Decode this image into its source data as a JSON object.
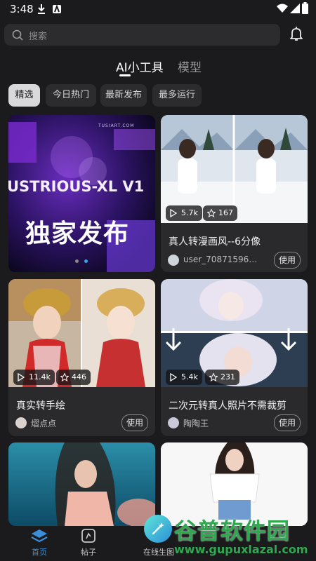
{
  "status": {
    "time": "3:48"
  },
  "search": {
    "placeholder": "搜索"
  },
  "tabs": [
    {
      "label": "AI小工具"
    },
    {
      "label": "模型"
    }
  ],
  "chips": [
    {
      "label": "精选"
    },
    {
      "label": "今日热门"
    },
    {
      "label": "最新发布"
    },
    {
      "label": "最多运行"
    }
  ],
  "banner": {
    "brand": "TUSIART.COM",
    "headline": "USTRIOUS-XL V1",
    "subtitle": "独家发布"
  },
  "cards": [
    {
      "title": "真人转漫画风--6分像",
      "user": "user_7087159680...",
      "runs": "5.7k",
      "stars": "167",
      "button": "使用"
    },
    {
      "title": "真实转手绘",
      "user": "熠点点",
      "runs": "11.4k",
      "stars": "446",
      "button": "使用"
    },
    {
      "title": "二次元转真人照片不需裁剪",
      "user": "陶陶王",
      "runs": "5.4k",
      "stars": "231",
      "button": "使用"
    }
  ],
  "bottom_nav": [
    {
      "label": "首页"
    },
    {
      "label": "帖子"
    },
    {
      "label": "在线生图"
    }
  ],
  "watermark": {
    "text_main": "谷普软件园",
    "text_url": "www.gupuxlazal.com"
  },
  "colors": {
    "accent": "#3b8fd8",
    "background": "#1b1b1d",
    "card": "#2a2a2c"
  }
}
